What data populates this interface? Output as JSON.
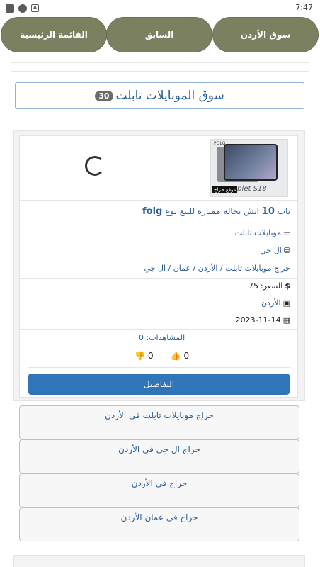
{
  "status_bar": {
    "time": "7:47"
  },
  "nav": {
    "home_label": "القائمة الرئيسية",
    "prev_label": "السابق",
    "market_label": "سوق الأردن"
  },
  "page_title": {
    "text": "سوق الموبايلات تابلت",
    "count": "30"
  },
  "listing": {
    "image_caption": "Tablet S18",
    "image_brand": "POLG",
    "image_stamp": "موقع حراج",
    "title_prefix": "تاب",
    "title_num": "10",
    "title_mid": "انش بحاله ممتازه للبيع نوع",
    "title_brand": "folg",
    "category": "موبايلات تابلت",
    "brand": "ال جي",
    "breadcrumb": "حراج موبايلات تابلت / الأردن / عمان / ال جي",
    "price_label": "السعر:",
    "price_value": "75",
    "country": "الأردن",
    "date": "2023-11-14",
    "views_label": "المشاهدات:",
    "views_value": "0",
    "likes": "0",
    "dislikes": "0",
    "details_label": "التفاصيل"
  },
  "related_links": [
    "حراج موبايلات تابلت في الأردن",
    "حراج ال جي في الأردن",
    "حراج في الأردن",
    "حراج في عمان الأردن"
  ],
  "colors": {
    "nav_bg": "#7a8060",
    "link": "#2a5f95",
    "button": "#2f75b8"
  }
}
